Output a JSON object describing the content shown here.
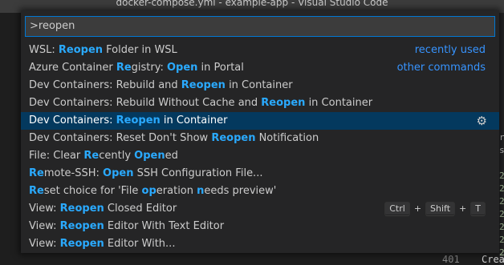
{
  "window": {
    "title": "docker-compose.yml - example-app - Visual Studio Code"
  },
  "quick_open": {
    "input_value": ">reopen",
    "items": [
      {
        "parts": [
          {
            "t": "WSL: ",
            "h": false
          },
          {
            "t": "Reopen",
            "h": true
          },
          {
            "t": " Folder in WSL",
            "h": false
          }
        ],
        "label_right": "recently used"
      },
      {
        "parts": [
          {
            "t": "Azure Container ",
            "h": false
          },
          {
            "t": "Re",
            "h": true
          },
          {
            "t": "gistry: ",
            "h": false
          },
          {
            "t": "Open",
            "h": true
          },
          {
            "t": " in Portal",
            "h": false
          }
        ],
        "label_right": "other commands"
      },
      {
        "parts": [
          {
            "t": "Dev Containers: Rebuild and ",
            "h": false
          },
          {
            "t": "Reopen",
            "h": true
          },
          {
            "t": " in Container",
            "h": false
          }
        ]
      },
      {
        "parts": [
          {
            "t": "Dev Containers: Rebuild Without Cache and ",
            "h": false
          },
          {
            "t": "Reopen",
            "h": true
          },
          {
            "t": " in Container",
            "h": false
          }
        ]
      },
      {
        "parts": [
          {
            "t": "Dev Containers: ",
            "h": false
          },
          {
            "t": "Reopen",
            "h": true
          },
          {
            "t": " in Container",
            "h": false
          }
        ],
        "selected": true,
        "gear": true
      },
      {
        "parts": [
          {
            "t": "Dev Containers: Reset Don't Show ",
            "h": false
          },
          {
            "t": "Reopen",
            "h": true
          },
          {
            "t": " Notification",
            "h": false
          }
        ]
      },
      {
        "parts": [
          {
            "t": "File: Clear ",
            "h": false
          },
          {
            "t": "Re",
            "h": true
          },
          {
            "t": "cently ",
            "h": false
          },
          {
            "t": "Open",
            "h": true
          },
          {
            "t": "ed",
            "h": false
          }
        ]
      },
      {
        "parts": [
          {
            "t": "Re",
            "h": true
          },
          {
            "t": "mote-SSH: ",
            "h": false
          },
          {
            "t": "Open",
            "h": true
          },
          {
            "t": " SSH Configuration File...",
            "h": false
          }
        ]
      },
      {
        "parts": [
          {
            "t": "Re",
            "h": true
          },
          {
            "t": "set choice for 'File ",
            "h": false
          },
          {
            "t": "op",
            "h": true
          },
          {
            "t": "eration ",
            "h": false
          },
          {
            "t": "n",
            "h": true
          },
          {
            "t": "eeds preview'",
            "h": false
          }
        ]
      },
      {
        "parts": [
          {
            "t": "View: ",
            "h": false
          },
          {
            "t": "Reopen",
            "h": true
          },
          {
            "t": " Closed Editor",
            "h": false
          }
        ],
        "keybinding": [
          "Ctrl",
          "Shift",
          "T"
        ]
      },
      {
        "parts": [
          {
            "t": "View: ",
            "h": false
          },
          {
            "t": "Reopen",
            "h": true
          },
          {
            "t": " Editor With Text Editor",
            "h": false
          }
        ]
      },
      {
        "parts": [
          {
            "t": "View: ",
            "h": false
          },
          {
            "t": "Reopen",
            "h": true
          },
          {
            "t": " Editor With...",
            "h": false
          }
        ]
      }
    ]
  },
  "editor_background": {
    "right_glyphs": [
      "r",
      "s",
      "2",
      "2",
      "2",
      "2",
      "2",
      "2",
      "2"
    ],
    "line_number": "401",
    "line_text": "Crea"
  }
}
